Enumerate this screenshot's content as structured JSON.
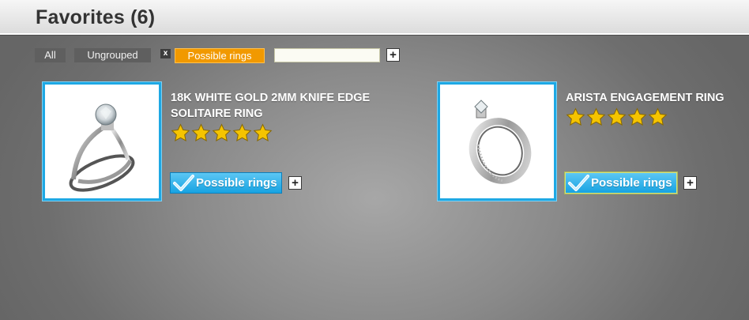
{
  "header": {
    "title": "Favorites (6)"
  },
  "filters": {
    "all_label": "All",
    "ungrouped_label": "Ungrouped",
    "remove_label": "x",
    "active_label": "Possible rings",
    "input_value": "",
    "input_placeholder": "",
    "add_label": "+"
  },
  "products": [
    {
      "name": "18K WHITE GOLD 2MM KNIFE EDGE SOLITAIRE RING",
      "rating": 5,
      "group_label": "Possible rings",
      "add_label": "+"
    },
    {
      "name": "ARISTA ENGAGEMENT RING",
      "rating": 5,
      "group_label": "Possible rings",
      "add_label": "+"
    }
  ],
  "colors": {
    "accent_orange": "#f19900",
    "accent_blue": "#1ea8e4",
    "star": "#f5c400"
  },
  "icons": [
    "close-icon",
    "plus-icon",
    "star-icon",
    "checkmark-icon",
    "ring-photo"
  ]
}
